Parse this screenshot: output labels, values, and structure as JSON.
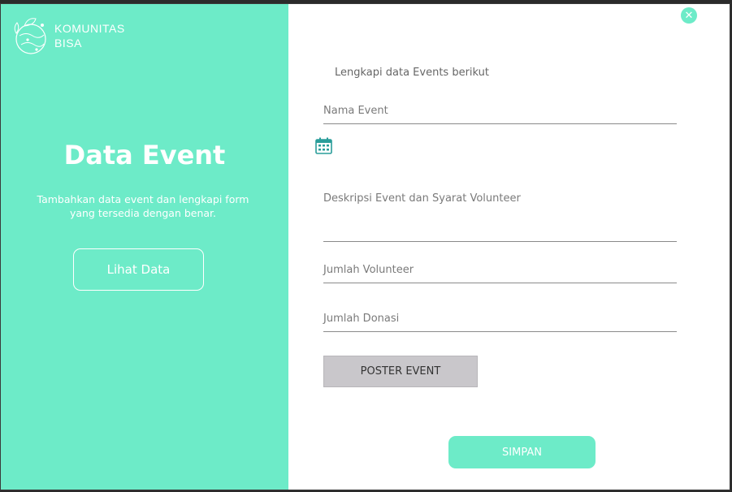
{
  "brand": {
    "name_line1": "KOMUNITAS",
    "name_line2": "BISA",
    "logo_icon": "globe-leaf-logo-icon"
  },
  "hero": {
    "title": "Data Event",
    "subtitle_line1": "Tambahkan data event dan lengkapi form",
    "subtitle_line2": "yang tersedia dengan benar.",
    "button_label": "Lihat Data"
  },
  "close_icon": "close-icon",
  "form": {
    "heading": "Lengkapi data Events berikut",
    "nama_event": "Nama Event",
    "calendar_icon": "calendar-icon",
    "deskripsi": "Deskripsi Event dan Syarat Volunteer",
    "jumlah_volunteer": "Jumlah Volunteer",
    "jumlah_donasi": "Jumlah Donasi",
    "poster_button": "POSTER EVENT",
    "submit_button": "SIMPAN"
  },
  "colors": {
    "accent": "#6debc8",
    "white": "#ffffff",
    "poster_button_bg": "#c9c7cb"
  }
}
